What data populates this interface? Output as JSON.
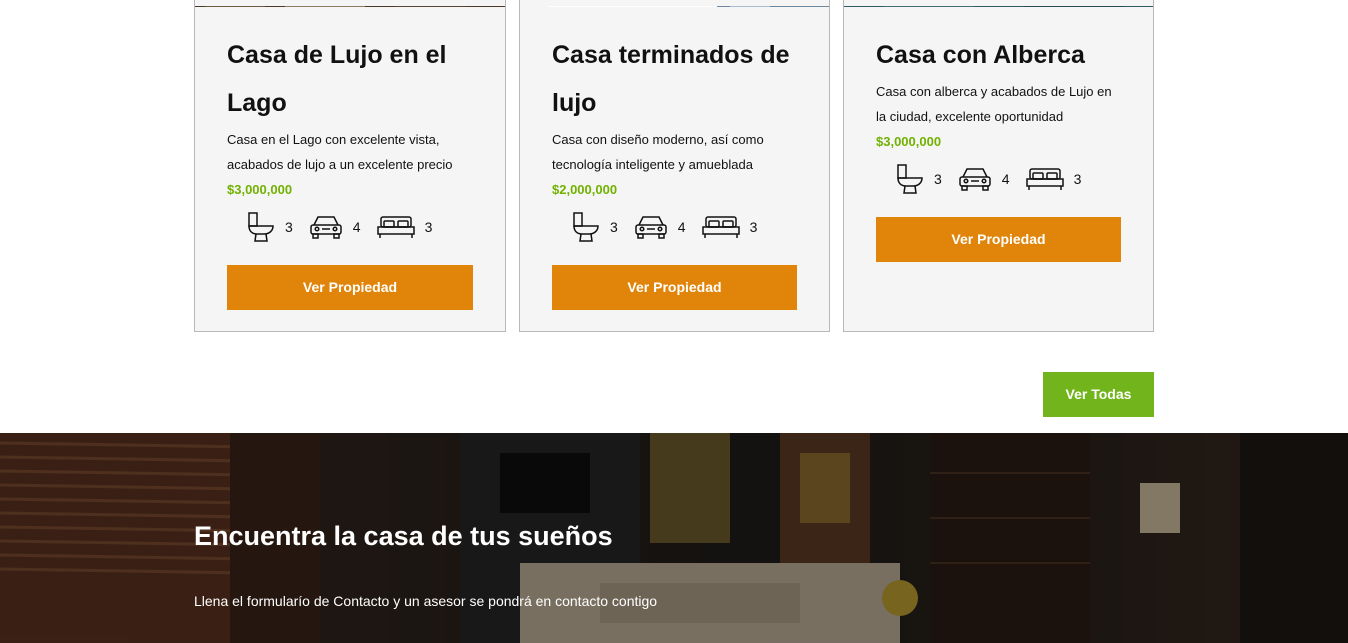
{
  "listings": [
    {
      "title": "Casa de Lujo en el Lago",
      "description": "Casa en el Lago con excelente vista, acabados de lujo a un excelente precio",
      "price": "$3,000,000",
      "bathrooms": "3",
      "parking": "4",
      "bedrooms": "3",
      "button_label": "Ver Propiedad"
    },
    {
      "title": "Casa terminados de lujo",
      "description": "Casa con diseño moderno, así como tecnología inteligente y amueblada",
      "price": "$2,000,000",
      "bathrooms": "3",
      "parking": "4",
      "bedrooms": "3",
      "button_label": "Ver Propiedad"
    },
    {
      "title": "Casa con Alberca",
      "description": "Casa con alberca y acabados de Lujo en la ciudad, excelente oportunidad",
      "price": "$3,000,000",
      "bathrooms": "3",
      "parking": "4",
      "bedrooms": "3",
      "button_label": "Ver Propiedad"
    }
  ],
  "view_all_label": "Ver Todas",
  "hero": {
    "title": "Encuentra la casa de tus sueños",
    "text": "Llena el formularío de Contacto y un asesor se pondrá en contacto contigo"
  },
  "icons": {
    "bathroom": "toilet-icon",
    "parking": "car-icon",
    "bedroom": "bed-icon"
  },
  "colors": {
    "price": "#71b100",
    "property_button": "#e0850a",
    "view_all_button": "#72b41b",
    "card_background": "#f5f5f5"
  }
}
